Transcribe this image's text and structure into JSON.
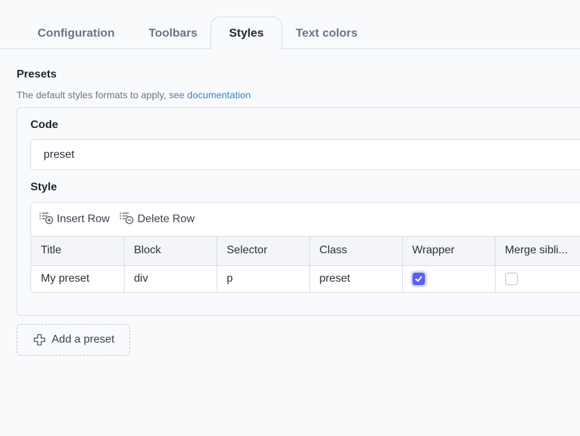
{
  "tabs": [
    {
      "label": "Configuration",
      "active": false
    },
    {
      "label": "Toolbars",
      "active": false
    },
    {
      "label": "Styles",
      "active": true
    },
    {
      "label": "Text colors",
      "active": false
    }
  ],
  "presets": {
    "title": "Presets",
    "help_text": "The default styles formats to apply, see ",
    "help_link": "documentation"
  },
  "code_field": {
    "label": "Code",
    "value": "preset"
  },
  "style_field": {
    "label": "Style"
  },
  "toolbar": {
    "insert_row": "Insert Row",
    "delete_row": "Delete Row"
  },
  "table": {
    "columns": [
      "Title",
      "Block",
      "Selector",
      "Class",
      "Wrapper",
      "Merge sibli..."
    ],
    "rows": [
      {
        "title": "My preset",
        "block": "div",
        "selector": "p",
        "class": "preset",
        "wrapper": true,
        "merge_siblings": false
      }
    ]
  },
  "add_button": {
    "label": "Add a preset"
  },
  "colors": {
    "accent": "#5a60f0",
    "link": "#3b7fd1",
    "border": "#d6dce6"
  }
}
